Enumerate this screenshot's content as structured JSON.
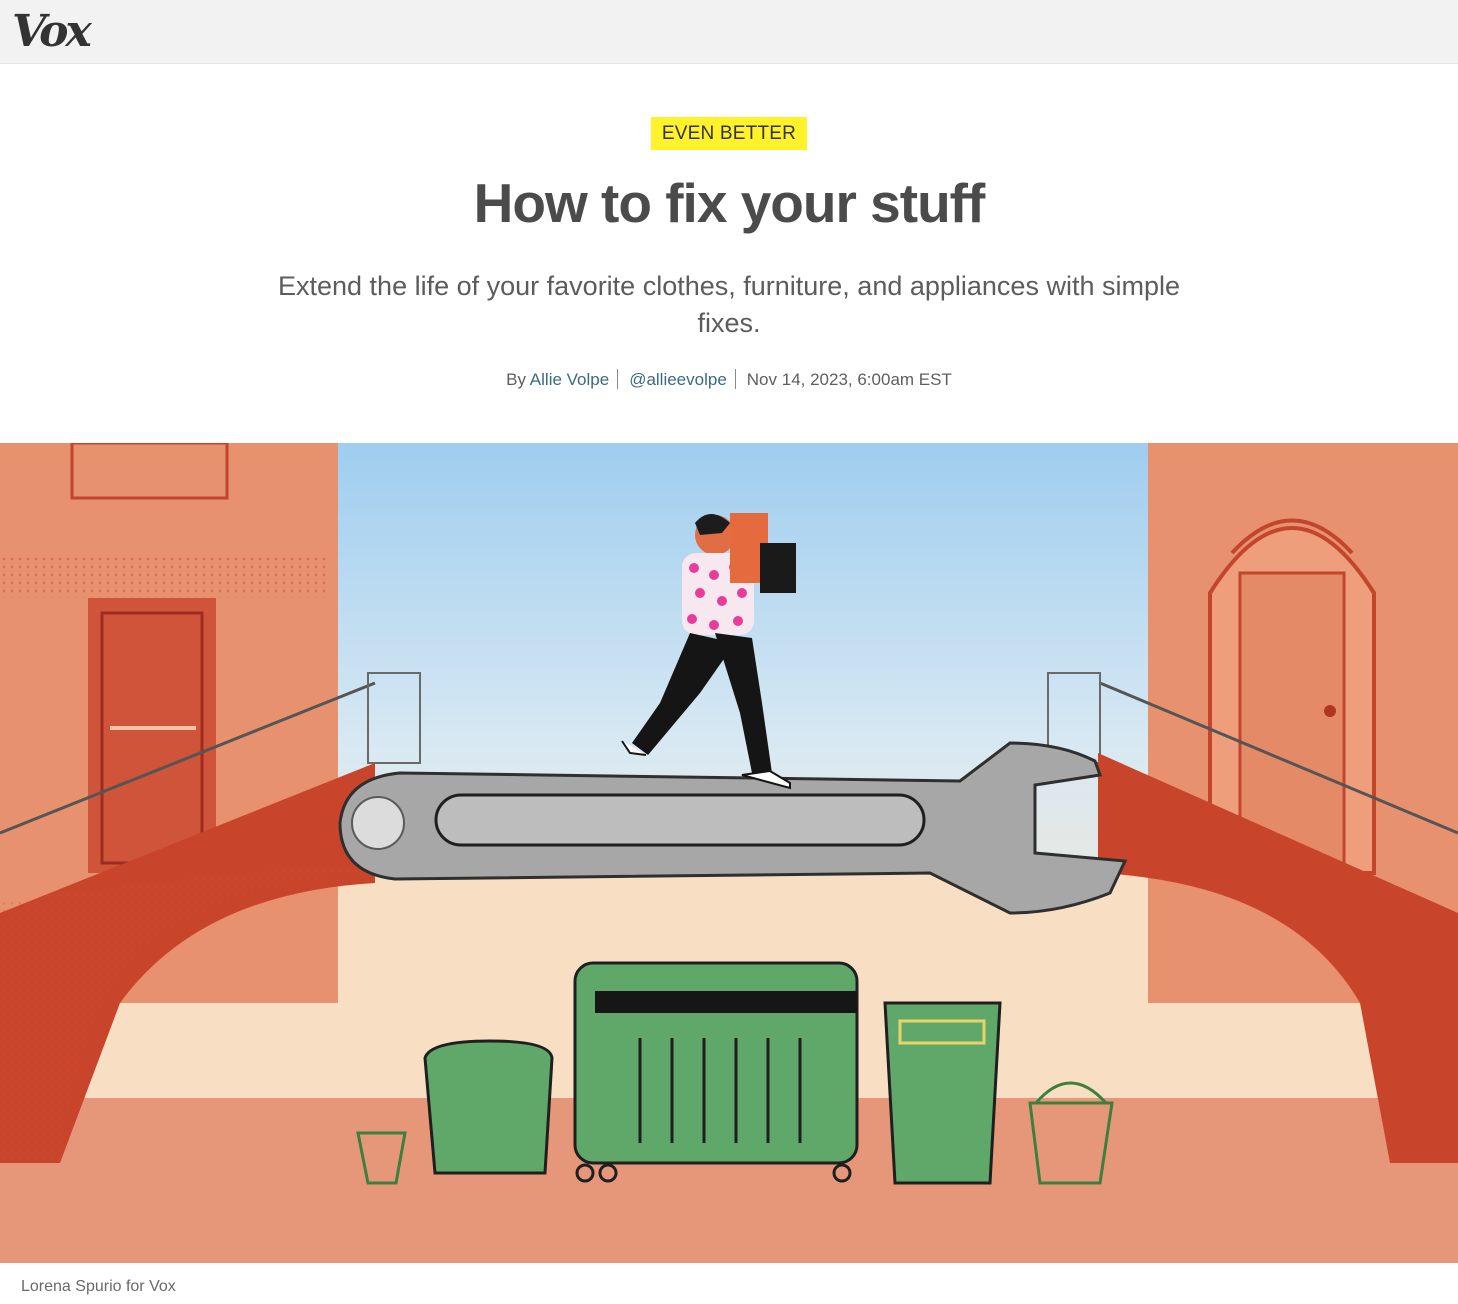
{
  "header": {
    "logo_text": "Vox"
  },
  "article": {
    "kicker": "EVEN BETTER",
    "headline": "How to fix your stuff",
    "dek": "Extend the life of your favorite clothes, furniture, and appliances with simple fixes.",
    "byline": {
      "prefix": "By",
      "author": "Allie Volpe",
      "handle": "@allieevolpe",
      "timestamp": "Nov 14, 2023, 6:00am EST"
    },
    "image_credit": "Lorena Spurio for Vox"
  },
  "colors": {
    "brand_yellow": "#fff22b",
    "link_blue": "#3b6b83",
    "headline_gray": "#4b4b4b",
    "header_bg": "#f1f2f1"
  }
}
